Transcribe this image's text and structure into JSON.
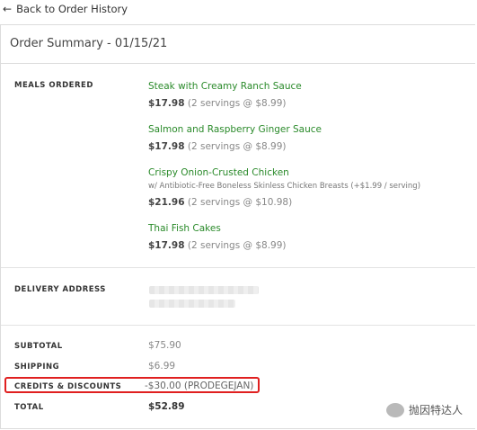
{
  "nav": {
    "back_label": "Back to Order History"
  },
  "summary": {
    "title": "Order Summary - 01/15/21"
  },
  "meals": {
    "label": "MEALS ORDERED",
    "items": [
      {
        "name": "Steak with Creamy Ranch Sauce",
        "price": "$17.98",
        "servings": "(2 servings @ $8.99)"
      },
      {
        "name": "Salmon and Raspberry Ginger Sauce",
        "price": "$17.98",
        "servings": "(2 servings @ $8.99)"
      },
      {
        "name": "Crispy Onion-Crusted Chicken",
        "sub": "w/ Antibiotic-Free Boneless Skinless Chicken Breasts (+$1.99 / serving)",
        "price": "$21.96",
        "servings": "(2 servings @ $10.98)"
      },
      {
        "name": "Thai Fish Cakes",
        "price": "$17.98",
        "servings": "(2 servings @ $8.99)"
      }
    ]
  },
  "delivery": {
    "label": "DELIVERY ADDRESS"
  },
  "totals": {
    "subtotal_label": "SUBTOTAL",
    "subtotal_value": "$75.90",
    "shipping_label": "SHIPPING",
    "shipping_value": "$6.99",
    "credits_label": "CREDITS & DISCOUNTS",
    "credits_value": "-$30.00 (PRODEGEJAN)",
    "total_label": "TOTAL",
    "total_value": "$52.89"
  },
  "watermark": {
    "text": "抛因特达人"
  },
  "colors": {
    "meal_name": "#2a8a2a",
    "highlight": "#e02020"
  }
}
